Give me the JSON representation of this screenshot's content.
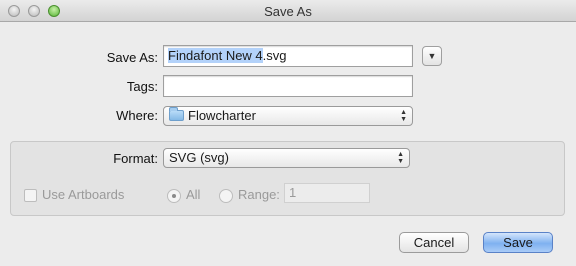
{
  "window": {
    "title": "Save As"
  },
  "form": {
    "save_as_label": "Save As:",
    "filename_selected": "Findafont New 4",
    "filename_ext": ".svg",
    "tags_label": "Tags:",
    "tags_value": "",
    "where_label": "Where:",
    "where_value": "Flowcharter"
  },
  "options": {
    "format_label": "Format:",
    "format_value": "SVG (svg)",
    "use_artboards_label": "Use Artboards",
    "all_label": "All",
    "range_label": "Range:",
    "range_value": "1"
  },
  "buttons": {
    "cancel": "Cancel",
    "save": "Save"
  }
}
